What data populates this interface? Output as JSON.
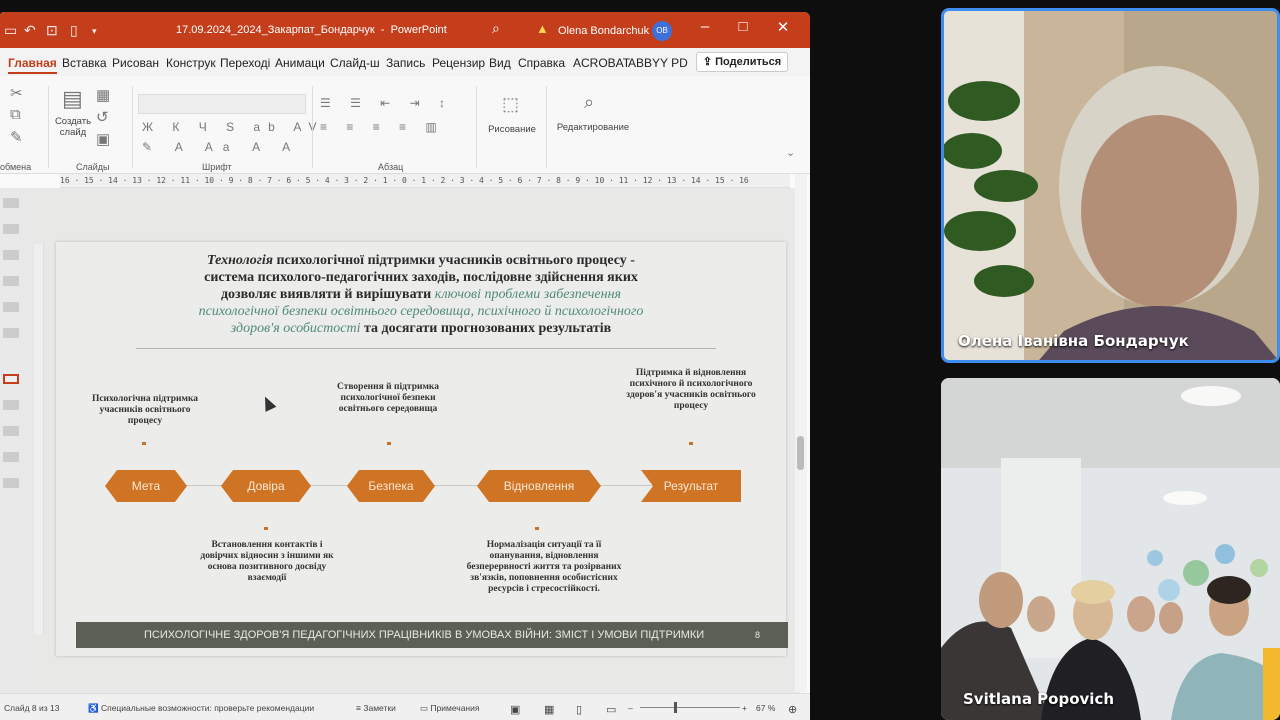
{
  "app": {
    "document_title": "17.09.2024_2024_Закарпат_Бондарчук",
    "app_name": "PowerPoint",
    "user_name": "Olena Bondarchuk",
    "user_initials": "OB"
  },
  "menu": {
    "tabs": [
      "Главная",
      "Вставка",
      "Рисован",
      "Конструк",
      "Переході",
      "Анимаци",
      "Слайд-ш",
      "Запись",
      "Рецензир",
      "Вид",
      "Справка",
      "ACROBAT",
      "ABBYY PD"
    ],
    "share_label": "Поделиться"
  },
  "ribbon": {
    "create_slide": "Создать слайд",
    "draw": "Рисование",
    "edit": "Редактирование",
    "groups": {
      "clipboard": "обмена",
      "slides": "Слайды",
      "font": "Шрифт",
      "paragraph": "Абзац"
    }
  },
  "ruler": "16 · 15 · 14 · 13 · 12 · 11 · 10 · 9 · 8 · 7 · 6 · 5 · 4 · 3 · 2 · 1 · 0 · 1 · 2 · 3 · 4 · 5 · 6 · 7 · 8 · 9 · 10 · 11 · 12 · 13 · 14 · 15 · 16",
  "slide": {
    "head_em": "Технологія",
    "head_line1": " психологічної підтримки учасників освітнього процесу -",
    "head_line2": "система психолого-педагогічних заходів, послідовне здійснення яких",
    "head_line3": "дозволяє виявляти й вирішувати ",
    "head_teal1": "ключові проблеми забезпечення",
    "head_teal2": "психологічної безпеки освітнього середовища, психічного й психологічного",
    "head_teal3": "здоров'я особистості",
    "head_end": "  та досягати прогнозованих результатів",
    "notes_top": {
      "meta": "Психологічна підтримка учасників освітнього процесу",
      "bezpeka": "Створення й підтримка психологічної безпеки освітнього середовища",
      "result": "Підтримка й відновлення психічного й психологічного здоров'я учасників освітнього процесу"
    },
    "notes_bottom": {
      "dovira": "Встановлення контактів і довірчих відносин з іншими як основа позитивного досвіду взаємодії",
      "vidnovlennya": "Нормалізація ситуації та її опанування, відновлення безперервності життя та розірваних зв'язків, поповнення особистісних ресурсів і стресостійкості."
    },
    "steps": [
      "Мета",
      "Довіра",
      "Безпека",
      "Відновлення",
      "Результат"
    ],
    "footer": "ПСИХОЛОГІЧНЕ ЗДОРОВ'Я ПЕДАГОГІЧНИХ ПРАЦІВНИКІВ В УМОВАХ ВІЙНИ: ЗМІСТ І УМОВИ ПІДТРИМКИ",
    "footer_num": "8"
  },
  "status": {
    "slide_counter": "Слайд 8 из 13",
    "accessibility": "Специальные возможности: проверьте рекомендации",
    "notes": "Заметки",
    "comments": "Примечания",
    "zoom": "67 %"
  },
  "participants": [
    {
      "name": "Олена Іванівна Бондарчук",
      "active_speaker": true
    },
    {
      "name": "Svitlana Popovich",
      "active_speaker": false
    }
  ],
  "colors": {
    "accent": "#c43e1c",
    "step_fill": "#cf7424",
    "footer_bar": "#5a6055",
    "active_speaker": "#3d8ef0"
  }
}
